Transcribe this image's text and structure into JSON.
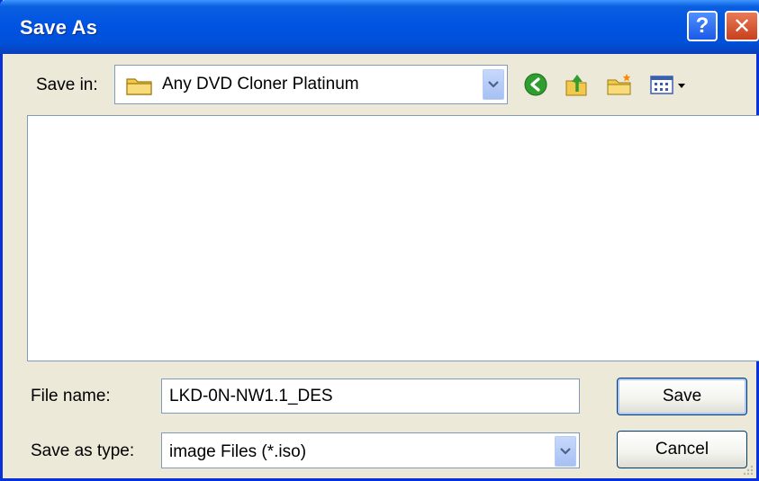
{
  "window": {
    "title": "Save As",
    "help_glyph": "?",
    "close_glyph": "✕"
  },
  "save_in": {
    "label": "Save in:",
    "value": "Any DVD Cloner Platinum"
  },
  "toolbar": {
    "icons": [
      "back-icon",
      "up-folder-icon",
      "new-folder-icon",
      "view-menu-icon"
    ]
  },
  "file_name": {
    "label": "File name:",
    "value": "LKD-0N-NW1.1_DES"
  },
  "save_as_type": {
    "label": "Save as type:",
    "value": "image Files (*.iso)"
  },
  "buttons": {
    "save": "Save",
    "cancel": "Cancel"
  },
  "colors": {
    "title_bar": "#0054e3",
    "dialog_bg": "#ece9d8",
    "field_border": "#7f9db9",
    "close_button": "#c8401c",
    "back_icon": "#2f9e2f",
    "folder": "#f2c94c"
  }
}
